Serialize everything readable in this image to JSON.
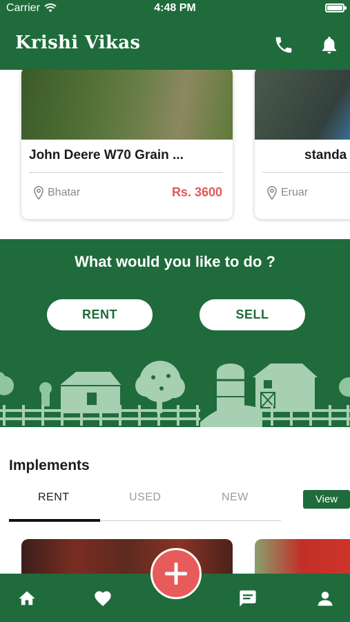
{
  "status_bar": {
    "carrier": "Carrier",
    "time": "4:48 PM"
  },
  "header": {
    "title": "Krishi Vikas",
    "icons": [
      "phone-icon",
      "bell-icon"
    ]
  },
  "listings": [
    {
      "name": "John Deere W70 Grain ...",
      "location": "Bhatar",
      "price": "Rs. 3600"
    },
    {
      "name": "standa",
      "location": "Eruar",
      "price": ""
    }
  ],
  "action": {
    "question": "What would you like to do ?",
    "rent_label": "RENT",
    "sell_label": "SELL"
  },
  "implements": {
    "title": "Implements",
    "tabs": [
      "RENT",
      "USED",
      "NEW"
    ],
    "active_tab": "RENT",
    "view_label": "View"
  },
  "bottom_nav": {
    "items": [
      "home-icon",
      "heart-icon",
      "add-icon",
      "chat-icon",
      "user-icon"
    ]
  },
  "colors": {
    "brand": "#1f6b3b",
    "accent": "#e85b5b",
    "price": "#e05959"
  }
}
